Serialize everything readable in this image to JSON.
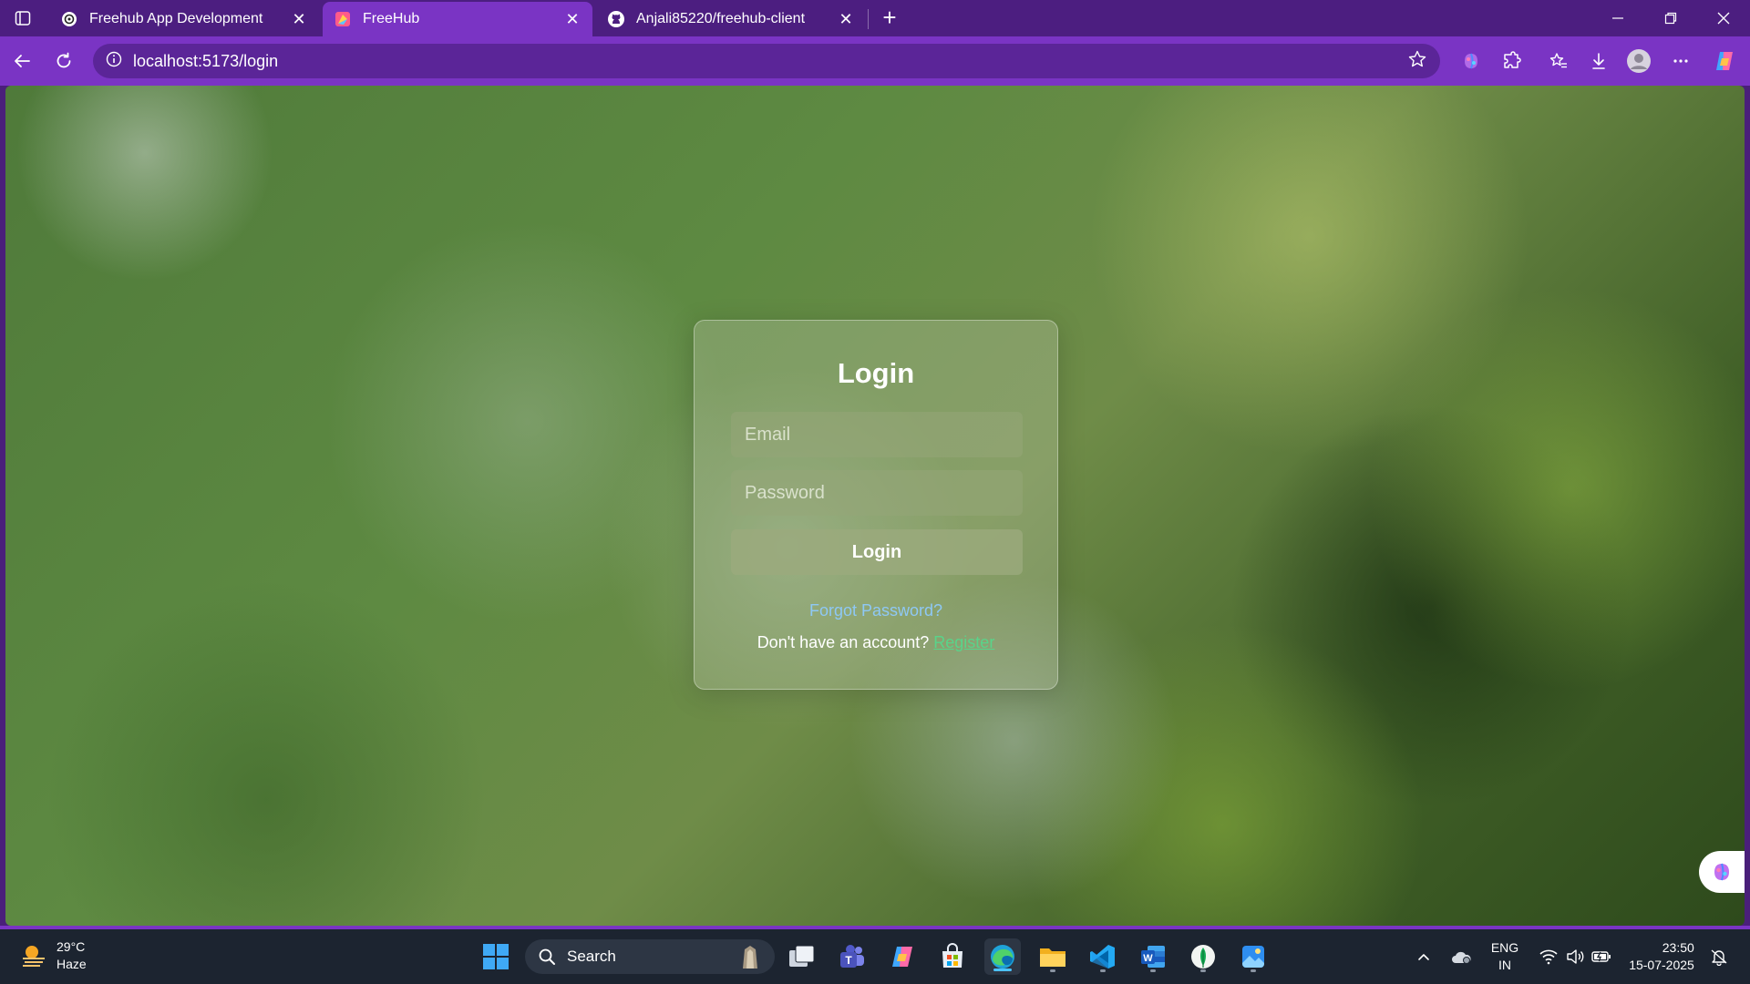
{
  "browser": {
    "tabs": [
      {
        "label": "Freehub App Development",
        "icon": "chatgpt-icon",
        "active": false
      },
      {
        "label": "FreeHub",
        "icon": "freehub-icon",
        "active": true
      },
      {
        "label": "Anjali85220/freehub-client",
        "icon": "github-icon",
        "active": false
      }
    ],
    "url": "localhost:5173/login",
    "accent": "#7a34c4"
  },
  "login": {
    "title": "Login",
    "email_placeholder": "Email",
    "password_placeholder": "Password",
    "button_label": "Login",
    "forgot_label": "Forgot Password?",
    "register_prompt": "Don't have an account?",
    "register_label": "Register"
  },
  "taskbar": {
    "weather": {
      "temp": "29°C",
      "condition": "Haze"
    },
    "search_label": "Search",
    "language": {
      "line1": "ENG",
      "line2": "IN"
    },
    "time": "23:50",
    "date": "15-07-2025"
  }
}
